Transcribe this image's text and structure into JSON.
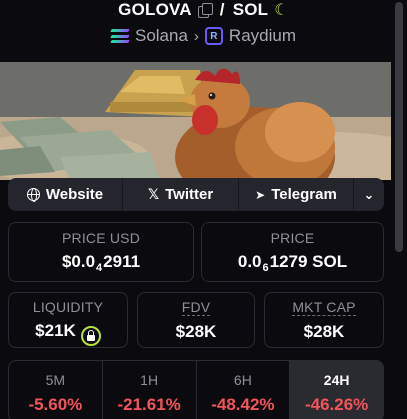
{
  "pair": {
    "base": "GOLOVA",
    "separator": "/",
    "quote": "SOL"
  },
  "chain": {
    "network": "Solana",
    "dex": "Raydium"
  },
  "links": {
    "website": "Website",
    "twitter": "Twitter",
    "telegram": "Telegram"
  },
  "price_usd": {
    "label": "PRICE USD",
    "prefix": "$0.0",
    "zeros": "4",
    "digits": "2911"
  },
  "price_native": {
    "label": "PRICE",
    "prefix": "0.0",
    "zeros": "6",
    "digits": "1279 SOL"
  },
  "liquidity": {
    "label": "LIQUIDITY",
    "value": "$21K"
  },
  "fdv": {
    "label": "FDV",
    "value": "$28K"
  },
  "market_cap": {
    "label": "MKT CAP",
    "value": "$28K"
  },
  "changes": [
    {
      "interval": "5M",
      "value": "-5.60%"
    },
    {
      "interval": "1H",
      "value": "-21.61%"
    },
    {
      "interval": "6H",
      "value": "-48.42%"
    },
    {
      "interval": "24H",
      "value": "-46.26%"
    }
  ],
  "colors": {
    "negative": "#f2545b",
    "accent": "#b6e33a",
    "background": "#0b0b0f"
  }
}
